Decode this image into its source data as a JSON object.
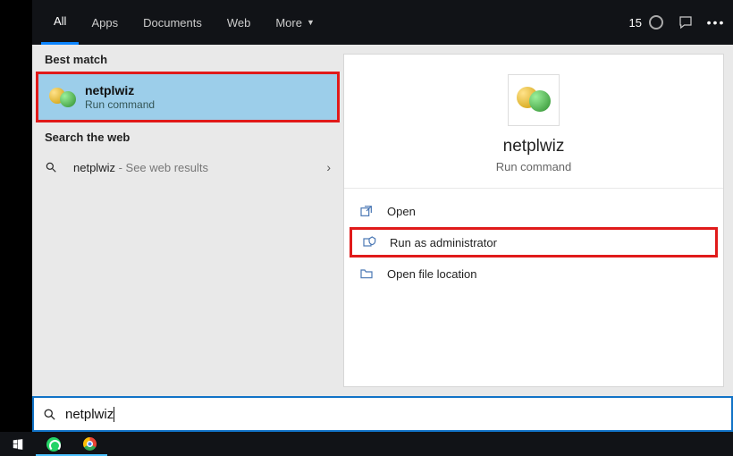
{
  "topbar": {
    "tabs": [
      {
        "label": "All",
        "active": true
      },
      {
        "label": "Apps",
        "active": false
      },
      {
        "label": "Documents",
        "active": false
      },
      {
        "label": "Web",
        "active": false
      },
      {
        "label": "More",
        "active": false,
        "chevron": true
      }
    ],
    "points": "15"
  },
  "left": {
    "best_match_label": "Best match",
    "best_match": {
      "title": "netplwiz",
      "subtitle": "Run command"
    },
    "web_label": "Search the web",
    "web_result": {
      "query": "netplwiz",
      "suffix": " - See web results"
    }
  },
  "right": {
    "title": "netplwiz",
    "subtitle": "Run command",
    "actions": [
      {
        "key": "open",
        "label": "Open"
      },
      {
        "key": "admin",
        "label": "Run as administrator",
        "boxed": true
      },
      {
        "key": "loc",
        "label": "Open file location"
      }
    ]
  },
  "search": {
    "value": "netplwiz"
  }
}
